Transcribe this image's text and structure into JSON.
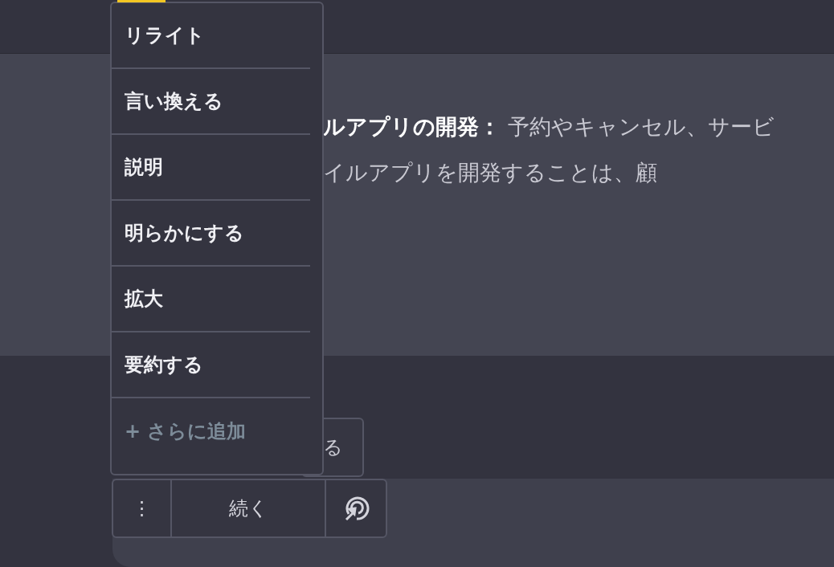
{
  "paragraph": {
    "line_1": "**ルアプリの開発：** 予約やキャンセル、サービ",
    "line_2": "イルアプリを開発することは、顧"
  },
  "hidden_button": {
    "label": "る"
  },
  "menu": {
    "items": [
      {
        "label": "リライト",
        "kind": "action"
      },
      {
        "label": "言い換える",
        "kind": "action"
      },
      {
        "label": "説明",
        "kind": "action"
      },
      {
        "label": "明らかにする",
        "kind": "action"
      },
      {
        "label": "拡大",
        "kind": "action"
      },
      {
        "label": "要約する",
        "kind": "action"
      },
      {
        "label": "+ さらに追加",
        "kind": "add"
      }
    ]
  },
  "toolbar": {
    "more": "⋮",
    "continue": "続く"
  }
}
